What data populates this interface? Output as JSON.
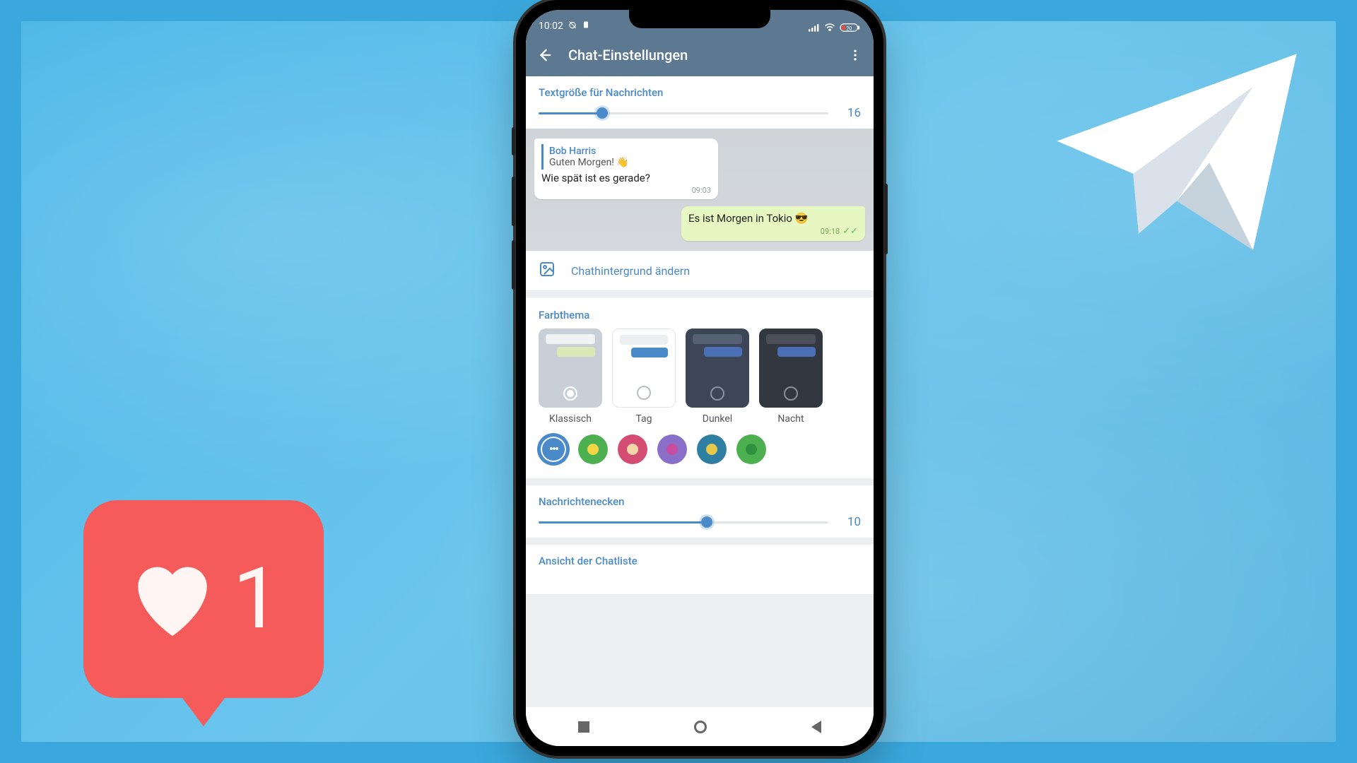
{
  "status": {
    "time": "10:02",
    "battery": "20"
  },
  "appbar": {
    "title": "Chat-Einstellungen"
  },
  "textsize": {
    "label": "Textgröße für Nachrichten",
    "value": "16",
    "percent": 22
  },
  "preview": {
    "reply_name": "Bob Harris",
    "reply_text": "Guten Morgen! 👋",
    "in_text": "Wie spät ist es gerade?",
    "in_time": "09:03",
    "out_text": "Es ist Morgen in Tokio 😎",
    "out_time": "09:18"
  },
  "wallpaper": {
    "label": "Chathintergrund ändern"
  },
  "themes": {
    "label": "Farbthema",
    "items": [
      {
        "label": "Klassisch",
        "bg": "#c8cfd6",
        "bar1": "#f0f2f4",
        "bar2": "#d9eab8",
        "selected": true,
        "radio_border": "#ffffff",
        "radio_fill": "#ffffff"
      },
      {
        "label": "Tag",
        "bg": "#ffffff",
        "bar1": "#eceef0",
        "bar2": "#4a8ac9",
        "selected": false,
        "radio_border": "#b9bec4",
        "radio_fill": "transparent"
      },
      {
        "label": "Dunkel",
        "bg": "#3d4657",
        "bar1": "#566074",
        "bar2": "#4a6fb5",
        "selected": false,
        "radio_border": "#8b93a3",
        "radio_fill": "transparent"
      },
      {
        "label": "Nacht",
        "bg": "#333740",
        "bar1": "#4a4f5a",
        "bar2": "#4a6fb5",
        "selected": false,
        "radio_border": "#8b8f98",
        "radio_fill": "transparent"
      }
    ],
    "accents": [
      {
        "outer": "#4a8ac9",
        "inner": "#4a8ac9",
        "selected": true
      },
      {
        "outer": "#4caf50",
        "inner": "#f2d648"
      },
      {
        "outer": "#d64d73",
        "inner": "#f2d6a8"
      },
      {
        "outer": "#8a6fc9",
        "inner": "#c94d9e"
      },
      {
        "outer": "#2f7fa3",
        "inner": "#e8c84a"
      },
      {
        "outer": "#4caf50",
        "inner": "#2f9040"
      }
    ]
  },
  "corners": {
    "label": "Nachrichtenecken",
    "value": "10",
    "percent": 58
  },
  "chatlist": {
    "label": "Ansicht der Chatliste"
  },
  "like": {
    "count": "1"
  }
}
